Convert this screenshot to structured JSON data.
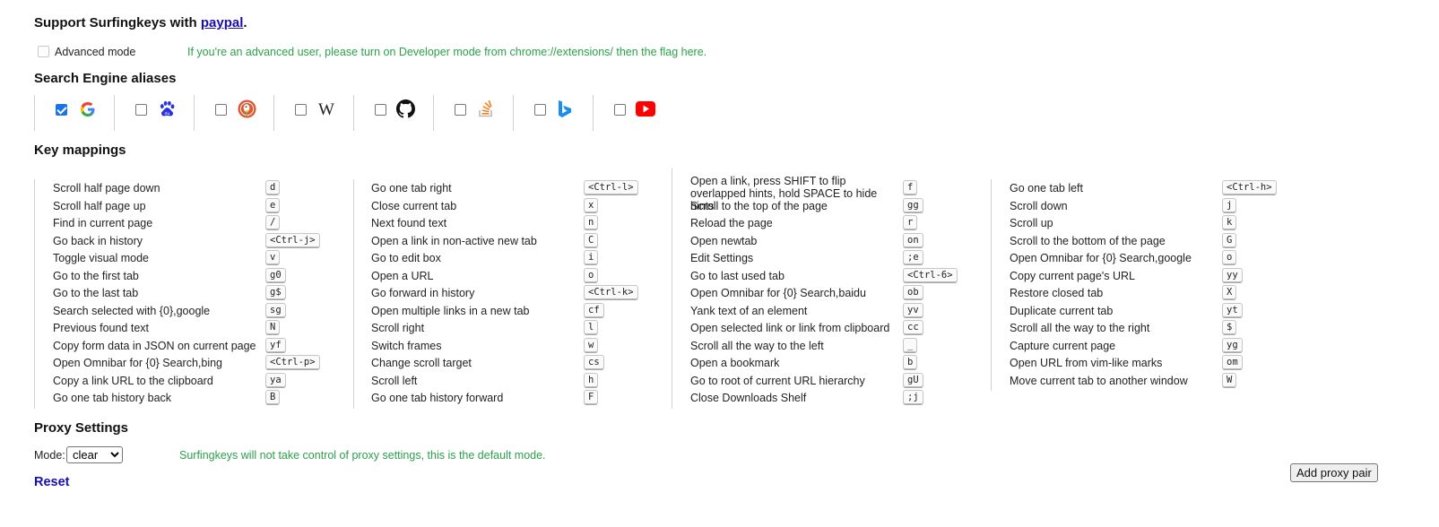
{
  "support": {
    "prefix": "Support Surfingkeys with ",
    "link": "paypal",
    "suffix": "."
  },
  "advanced": {
    "label": "Advanced mode",
    "hint": "If you're an advanced user, please turn on Developer mode from chrome://extensions/ then the flag here."
  },
  "search_engines": {
    "title": "Search Engine aliases",
    "items": [
      {
        "name": "google",
        "checked": true
      },
      {
        "name": "baidu",
        "checked": false
      },
      {
        "name": "duckduckgo",
        "checked": false
      },
      {
        "name": "wikipedia",
        "checked": false
      },
      {
        "name": "github",
        "checked": false
      },
      {
        "name": "stackoverflow",
        "checked": false
      },
      {
        "name": "bing",
        "checked": false
      },
      {
        "name": "youtube",
        "checked": false
      }
    ]
  },
  "key_mappings": {
    "title": "Key mappings",
    "columns": [
      [
        {
          "label": "Scroll half page down",
          "key": "d"
        },
        {
          "label": "Scroll half page up",
          "key": "e"
        },
        {
          "label": "Find in current page",
          "key": "/"
        },
        {
          "label": "Go back in history",
          "key": "<Ctrl-j>"
        },
        {
          "label": "Toggle visual mode",
          "key": "v"
        },
        {
          "label": "Go to the first tab",
          "key": "g0"
        },
        {
          "label": "Go to the last tab",
          "key": "g$"
        },
        {
          "label": "Search selected with {0},google",
          "key": "sg"
        },
        {
          "label": "Previous found text",
          "key": "N"
        },
        {
          "label": "Copy form data in JSON on current page",
          "key": "yf"
        },
        {
          "label": "Open Omnibar for {0} Search,bing",
          "key": "<Ctrl-p>"
        },
        {
          "label": "Copy a link URL to the clipboard",
          "key": "ya"
        },
        {
          "label": "Go one tab history back",
          "key": "B"
        }
      ],
      [
        {
          "label": "Go one tab right",
          "key": "<Ctrl-l>"
        },
        {
          "label": "Close current tab",
          "key": "x"
        },
        {
          "label": "Next found text",
          "key": "n"
        },
        {
          "label": "Open a link in non-active new tab",
          "key": "C"
        },
        {
          "label": "Go to edit box",
          "key": "i"
        },
        {
          "label": "Open a URL",
          "key": "o"
        },
        {
          "label": "Go forward in history",
          "key": "<Ctrl-k>"
        },
        {
          "label": "Open multiple links in a new tab",
          "key": "cf"
        },
        {
          "label": "Scroll right",
          "key": "l"
        },
        {
          "label": "Switch frames",
          "key": "w"
        },
        {
          "label": "Change scroll target",
          "key": "cs"
        },
        {
          "label": "Scroll left",
          "key": "h"
        },
        {
          "label": "Go one tab history forward",
          "key": "F"
        }
      ],
      [
        {
          "label": "Open a link, press SHIFT to flip overlapped hints, hold SPACE to hide hints",
          "key": "f"
        },
        {
          "label": "Scroll to the top of the page",
          "key": "gg"
        },
        {
          "label": "Reload the page",
          "key": "r"
        },
        {
          "label": "Open newtab",
          "key": "on"
        },
        {
          "label": "Edit Settings",
          "key": ";e"
        },
        {
          "label": "Go to last used tab",
          "key": "<Ctrl-6>"
        },
        {
          "label": "Open Omnibar for {0} Search,baidu",
          "key": "ob"
        },
        {
          "label": "Yank text of an element",
          "key": "yv"
        },
        {
          "label": "Open selected link or link from clipboard",
          "key": "cc"
        },
        {
          "label": "Scroll all the way to the left",
          "key": "_"
        },
        {
          "label": "Open a bookmark",
          "key": "b"
        },
        {
          "label": "Go to root of current URL hierarchy",
          "key": "gU"
        },
        {
          "label": "Close Downloads Shelf",
          "key": ";j"
        }
      ],
      [
        {
          "label": "Go one tab left",
          "key": "<Ctrl-h>"
        },
        {
          "label": "Scroll down",
          "key": "j"
        },
        {
          "label": "Scroll up",
          "key": "k"
        },
        {
          "label": "Scroll to the bottom of the page",
          "key": "G"
        },
        {
          "label": "Open Omnibar for {0} Search,google",
          "key": "o"
        },
        {
          "label": "Copy current page's URL",
          "key": "yy"
        },
        {
          "label": "Restore closed tab",
          "key": "X"
        },
        {
          "label": "Duplicate current tab",
          "key": "yt"
        },
        {
          "label": "Scroll all the way to the right",
          "key": "$"
        },
        {
          "label": "Capture current page",
          "key": "yg"
        },
        {
          "label": "Open URL from vim-like marks",
          "key": "om"
        },
        {
          "label": "Move current tab to another window",
          "key": "W"
        }
      ]
    ]
  },
  "proxy": {
    "title": "Proxy Settings",
    "mode_label": "Mode:",
    "mode_value": "clear",
    "hint": "Surfingkeys will not take control of proxy settings, this is the default mode.",
    "add_button": "Add proxy pair"
  },
  "reset_label": "Reset",
  "colors": {
    "hint_green": "#2aa14a",
    "link_blue": "#1a0dab"
  }
}
